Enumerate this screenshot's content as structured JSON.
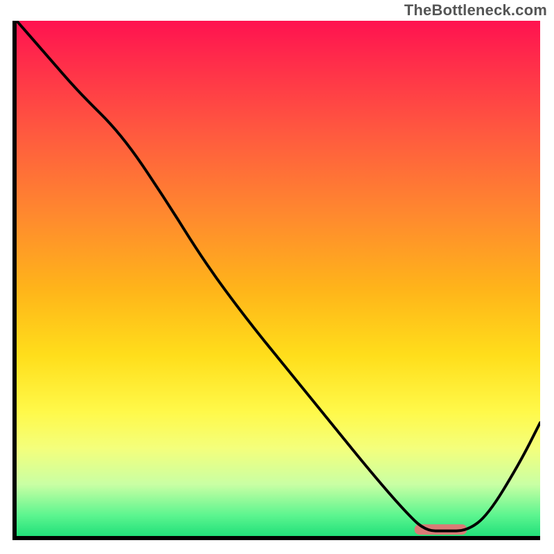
{
  "watermark": "TheBottleneck.com",
  "colors": {
    "axis": "#000000",
    "curve": "#000000",
    "marker": "#d97b76",
    "gradient_top": "#ff1250",
    "gradient_mid": "#ffde1b",
    "gradient_bottom": "#22e07a"
  },
  "chart_data": {
    "type": "line",
    "title": "",
    "xlabel": "",
    "ylabel": "",
    "xlim": [
      0,
      100
    ],
    "ylim": [
      0,
      100
    ],
    "x": [
      0,
      6,
      12,
      20,
      28,
      36,
      44,
      52,
      60,
      68,
      74,
      78,
      82,
      86,
      90,
      96,
      100
    ],
    "values": [
      100,
      93,
      86,
      78,
      66,
      53,
      42,
      32,
      22,
      12,
      5,
      1,
      1,
      1,
      4,
      14,
      22
    ],
    "marker": {
      "x_start": 76,
      "x_end": 86,
      "y": 1.2
    }
  }
}
